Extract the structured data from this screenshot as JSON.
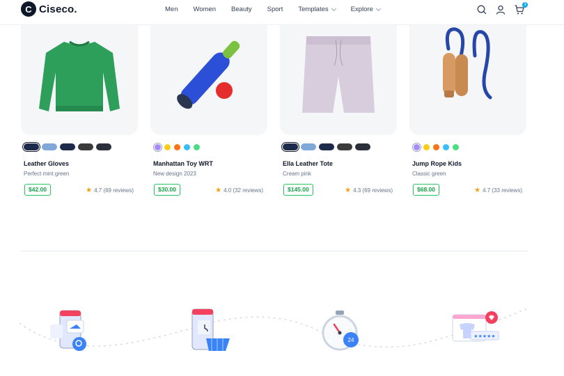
{
  "header": {
    "logo_mark": "C",
    "logo_text": "Ciseco.",
    "nav": [
      {
        "label": "Men",
        "dropdown": false
      },
      {
        "label": "Women",
        "dropdown": false
      },
      {
        "label": "Beauty",
        "dropdown": false
      },
      {
        "label": "Sport",
        "dropdown": false
      },
      {
        "label": "Templates",
        "dropdown": true
      },
      {
        "label": "Explore",
        "dropdown": true
      }
    ],
    "icons": [
      "search-icon",
      "user-icon",
      "cart-icon"
    ],
    "cart_count": "3"
  },
  "products": [
    {
      "name": "Leather Gloves",
      "subtitle": "Perfect mint green",
      "price": "$42.00",
      "rating": "4.7 (69 reviews)",
      "swatch_type": "pattern",
      "swatches": [
        "#1e2a4a",
        "#7fa8d8",
        "#1e2a4a",
        "#3a3a3a",
        "#2a2f3a"
      ]
    },
    {
      "name": "Manhattan Toy WRT",
      "subtitle": "New design 2023",
      "price": "$30.00",
      "rating": "4.0 (32 reviews)",
      "swatch_type": "color",
      "swatches": [
        "#a78bfa",
        "#facc15",
        "#f97316",
        "#38bdf8",
        "#4ade80"
      ]
    },
    {
      "name": "Ella Leather Tote",
      "subtitle": "Cream pink",
      "price": "$145.00",
      "rating": "4.3 (69 reviews)",
      "swatch_type": "pattern",
      "swatches": [
        "#1e2a4a",
        "#7fa8d8",
        "#1e2a4a",
        "#3a3a3a",
        "#2a2f3a"
      ]
    },
    {
      "name": "Jump Rope Kids",
      "subtitle": "Classic green",
      "price": "$68.00",
      "rating": "4.7 (33 reviews)",
      "swatch_type": "color",
      "swatches": [
        "#a78bfa",
        "#facc15",
        "#f97316",
        "#38bdf8",
        "#4ade80"
      ]
    }
  ],
  "steps": {
    "icons": [
      "shopping-search-icon",
      "cart-basket-icon",
      "timer-24-icon",
      "favorite-review-icon"
    ],
    "tag_colors": [
      "#fecaca",
      "#c7d2fe",
      "#fde68a",
      "#e9d5ff"
    ]
  },
  "colors": {
    "accent_green": "#16a34a",
    "star": "#f59e0b",
    "card_bg": "#f5f6f8"
  }
}
